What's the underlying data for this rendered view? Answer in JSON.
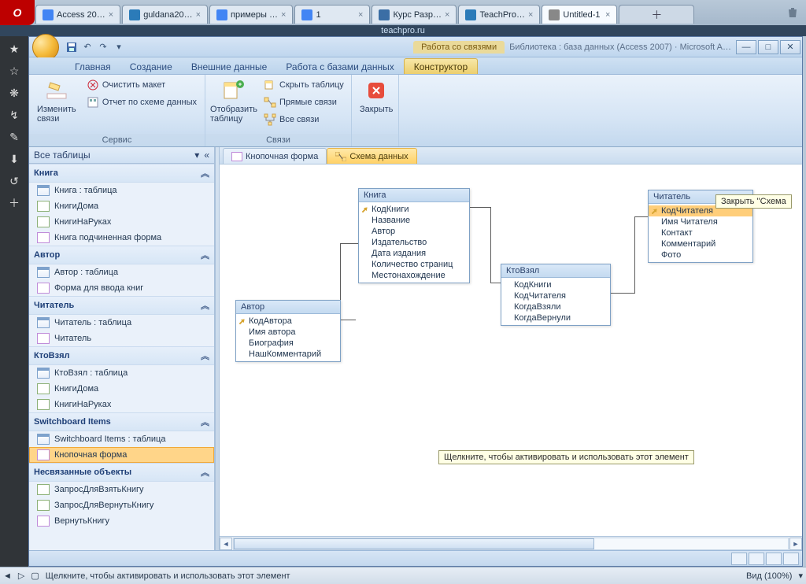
{
  "browser": {
    "url": "teachpro.ru",
    "tabs": [
      {
        "label": "Access 20…",
        "iconColor": "#4285f4"
      },
      {
        "label": "guldana20…",
        "iconColor": "#2b7bb9"
      },
      {
        "label": "примеры …",
        "iconColor": "#4285f4"
      },
      {
        "label": "1",
        "iconColor": "#4285f4"
      },
      {
        "label": "Курс Разр…",
        "iconColor": "#3b6ea5"
      },
      {
        "label": "TeachPro…",
        "iconColor": "#2b7bb9"
      },
      {
        "label": "Untitled-1",
        "iconColor": "#888",
        "active": true
      }
    ]
  },
  "access": {
    "contextTitle": "Работа со связями",
    "docTitle": "Библиотека : база данных (Access 2007) · Microsoft A…",
    "tabs": {
      "home": "Главная",
      "create": "Создание",
      "external": "Внешние данные",
      "dbtools": "Работа с базами данных",
      "designer": "Конструктор"
    },
    "ribbon": {
      "groupService": "Сервис",
      "groupRelations": "Связи",
      "editRelations": "Изменить связи",
      "clearLayout": "Очистить макет",
      "relationReport": "Отчет по схеме данных",
      "showTable": "Отобразить таблицу",
      "hideTable": "Скрыть таблицу",
      "directRelations": "Прямые связи",
      "allRelations": "Все связи",
      "close": "Закрыть"
    },
    "navHeader": "Все таблицы",
    "navGroups": [
      {
        "title": "Книга",
        "items": [
          {
            "label": "Книга : таблица",
            "type": "table"
          },
          {
            "label": "КнигиДома",
            "type": "query"
          },
          {
            "label": "КнигиНаРуках",
            "type": "query"
          },
          {
            "label": "Книга подчиненная форма",
            "type": "form"
          }
        ]
      },
      {
        "title": "Автор",
        "items": [
          {
            "label": "Автор : таблица",
            "type": "table"
          },
          {
            "label": "Форма для ввода книг",
            "type": "form"
          }
        ]
      },
      {
        "title": "Читатель",
        "items": [
          {
            "label": "Читатель : таблица",
            "type": "table"
          },
          {
            "label": "Читатель",
            "type": "form"
          }
        ]
      },
      {
        "title": "КтоВзял",
        "items": [
          {
            "label": "КтоВзял : таблица",
            "type": "table"
          },
          {
            "label": "КнигиДома",
            "type": "query"
          },
          {
            "label": "КнигиНаРуках",
            "type": "query"
          }
        ]
      },
      {
        "title": "Switchboard Items",
        "items": [
          {
            "label": "Switchboard Items : таблица",
            "type": "table"
          },
          {
            "label": "Кнопочная форма",
            "type": "form",
            "selected": true
          }
        ]
      },
      {
        "title": "Несвязанные объекты",
        "items": [
          {
            "label": "ЗапросДляВзятьКнигу",
            "type": "query"
          },
          {
            "label": "ЗапросДляВернутьКнигу",
            "type": "query"
          },
          {
            "label": "ВернутьКнигу",
            "type": "form"
          }
        ]
      }
    ],
    "docTabs": {
      "form": "Кнопочная форма",
      "schema": "Схема данных"
    },
    "tables": {
      "avtor": {
        "title": "Автор",
        "fields": [
          "КодАвтора",
          "Имя автора",
          "Биография",
          "НашКомментарий"
        ],
        "key": 0
      },
      "kniga": {
        "title": "Книга",
        "fields": [
          "КодКниги",
          "Название",
          "Автор",
          "Издательство",
          "Дата издания",
          "Количество страниц",
          "Местонахождение"
        ],
        "key": 0
      },
      "ktovzyal": {
        "title": "КтоВзял",
        "fields": [
          "КодКниги",
          "КодЧитателя",
          "КогдаВзяли",
          "КогдаВернули"
        ]
      },
      "chitatel": {
        "title": "Читатель",
        "fields": [
          "КодЧитателя",
          "Имя Читателя",
          "Контакт",
          "Комментарий",
          "Фото"
        ],
        "key": 0,
        "sel": 0
      }
    },
    "tooltipClose": "Закрыть ''Схема",
    "tooltipActivate": "Щелкните, чтобы активировать и использовать этот элемент",
    "statusText": "Щелкните, чтобы активировать и использовать этот элемент",
    "viewLabel": "Вид (100%)",
    "statusReady": ""
  }
}
